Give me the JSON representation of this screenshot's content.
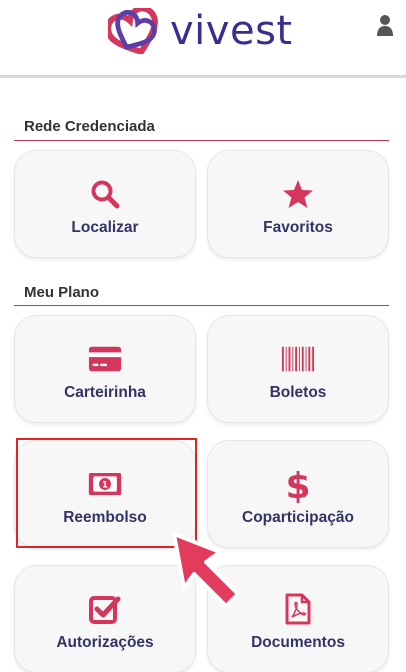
{
  "header": {
    "brand": "vivest",
    "logo_icon": "vivest-heart-logo",
    "user_icon": "user-icon"
  },
  "sections": [
    {
      "title": "Rede Credenciada",
      "items": [
        {
          "label": "Localizar",
          "icon": "search-icon"
        },
        {
          "label": "Favoritos",
          "icon": "star-icon"
        }
      ]
    },
    {
      "title": "Meu Plano",
      "items": [
        {
          "label": "Carteirinha",
          "icon": "card-icon"
        },
        {
          "label": "Boletos",
          "icon": "barcode-icon"
        },
        {
          "label": "Reembolso",
          "icon": "money-bill-icon"
        },
        {
          "label": "Coparticipação",
          "icon": "dollar-icon"
        },
        {
          "label": "Autorizações",
          "icon": "checkbox-icon"
        },
        {
          "label": "Documentos",
          "icon": "pdf-document-icon"
        }
      ]
    }
  ],
  "colors": {
    "accent": "#d4375b",
    "brand": "#3e2b8f",
    "label": "#333366",
    "highlight": "#e02424"
  }
}
